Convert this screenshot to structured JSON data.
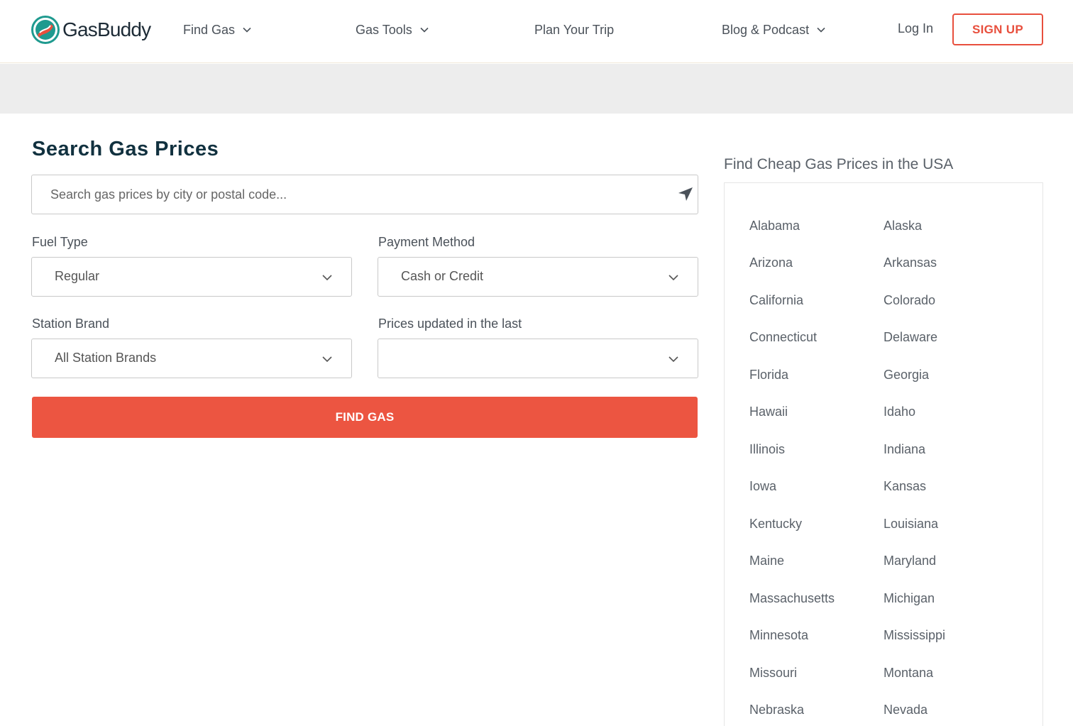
{
  "brand": {
    "name": "GasBuddy"
  },
  "nav": {
    "find_gas": "Find Gas",
    "gas_tools": "Gas Tools",
    "plan_trip": "Plan Your Trip",
    "blog": "Blog & Podcast",
    "login": "Log In",
    "signup": "SIGN UP"
  },
  "search": {
    "title": "Search Gas Prices",
    "placeholder": "Search gas prices by city or postal code...",
    "fuel_label": "Fuel Type",
    "fuel_value": "Regular",
    "payment_label": "Payment Method",
    "payment_value": "Cash or Credit",
    "brand_label": "Station Brand",
    "brand_value": "All Station Brands",
    "updated_label": "Prices updated in the last",
    "updated_value": "",
    "button": "FIND GAS"
  },
  "sidebar": {
    "title": "Find Cheap Gas Prices in the USA",
    "states": [
      "Alabama",
      "Alaska",
      "Arizona",
      "Arkansas",
      "California",
      "Colorado",
      "Connecticut",
      "Delaware",
      "Florida",
      "Georgia",
      "Hawaii",
      "Idaho",
      "Illinois",
      "Indiana",
      "Iowa",
      "Kansas",
      "Kentucky",
      "Louisiana",
      "Maine",
      "Maryland",
      "Massachusetts",
      "Michigan",
      "Minnesota",
      "Mississippi",
      "Missouri",
      "Montana",
      "Nebraska",
      "Nevada"
    ]
  },
  "colors": {
    "accent": "#ec5541",
    "title": "#11313f",
    "band": "#ededed"
  }
}
